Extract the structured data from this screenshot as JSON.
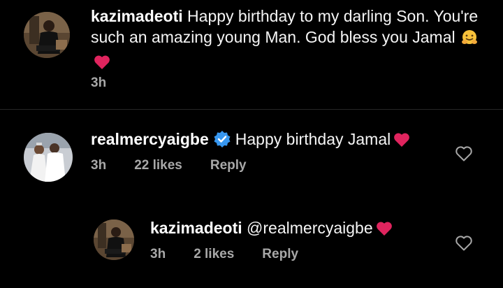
{
  "comments": [
    {
      "username": "kazimadeoti",
      "text": "Happy birthday to my darling Son. You're such an amazing young Man. God bless you Jamal",
      "time": "3h",
      "emojis": [
        "hugging-face",
        "red-heart"
      ]
    },
    {
      "username": "realmercyaigbe",
      "verified": true,
      "text": "Happy birthday Jamal",
      "time": "3h",
      "likes": "22 likes",
      "reply_label": "Reply",
      "emojis": [
        "red-heart"
      ]
    },
    {
      "username": "kazimadeoti",
      "text": "@realmercyaigbe",
      "time": "3h",
      "likes": "2 likes",
      "reply_label": "Reply",
      "emojis": [
        "red-heart"
      ]
    }
  ],
  "icons": {
    "like": "heart-outline-icon",
    "verified": "verified-badge-icon"
  },
  "colors": {
    "background": "#000000",
    "text": "#f5f5f5",
    "meta": "#a8a8a8",
    "heart": "#e0245e",
    "verified": "#3797f0"
  }
}
